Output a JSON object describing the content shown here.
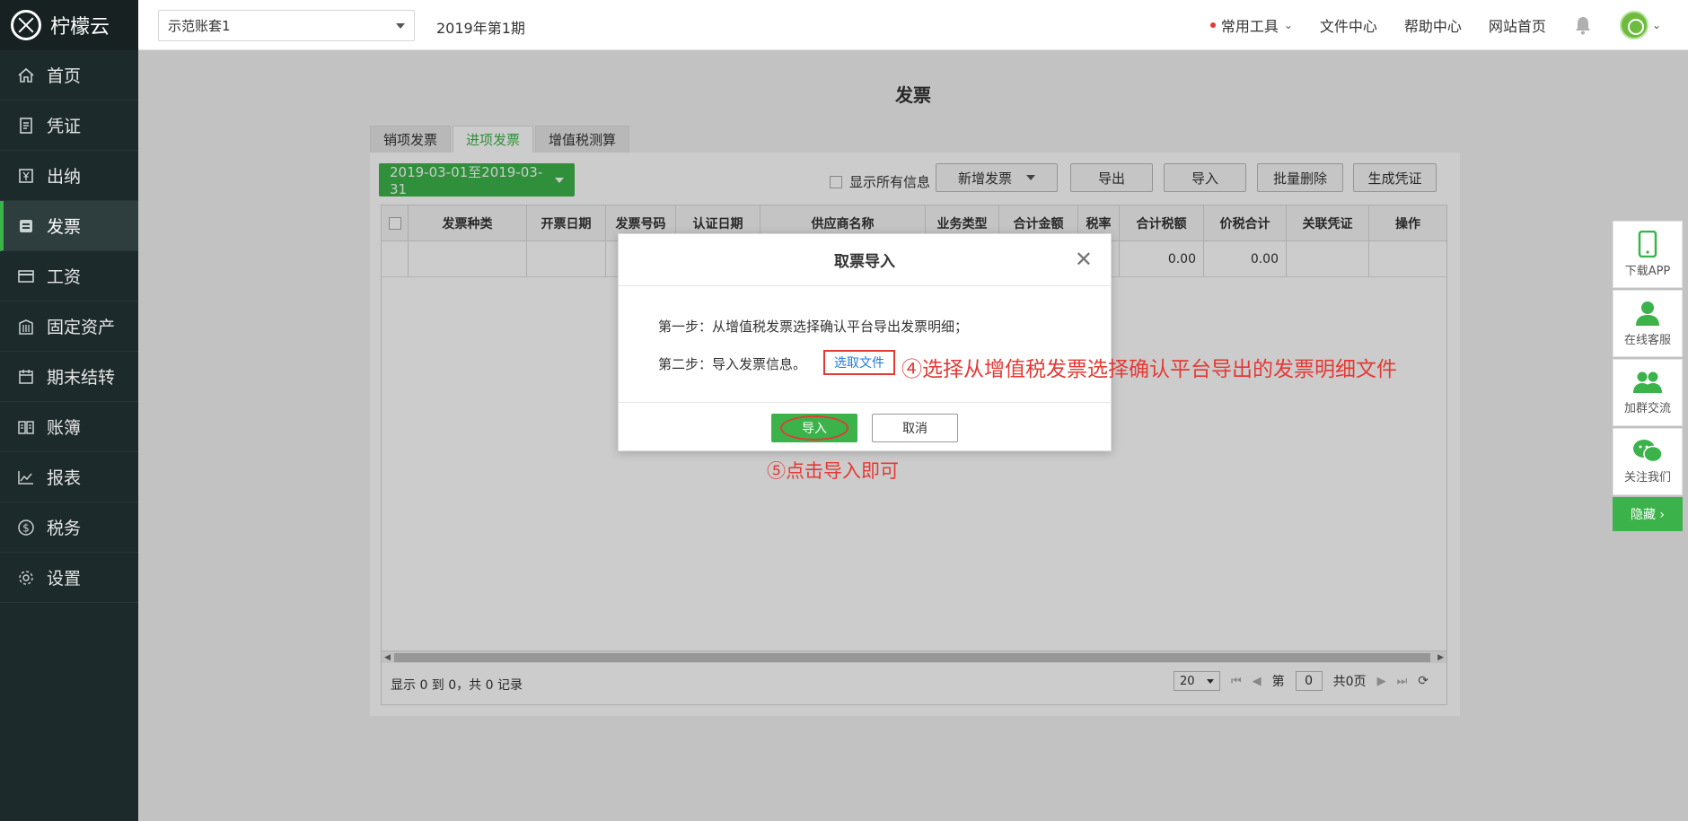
{
  "app": {
    "name": "柠檬云"
  },
  "sidebar": {
    "items": [
      {
        "label": "首页",
        "icon": "home-icon"
      },
      {
        "label": "凭证",
        "icon": "document-icon"
      },
      {
        "label": "出纳",
        "icon": "cashier-icon"
      },
      {
        "label": "发票",
        "icon": "invoice-icon",
        "active": true
      },
      {
        "label": "工资",
        "icon": "card-icon"
      },
      {
        "label": "固定资产",
        "icon": "building-icon"
      },
      {
        "label": "期末结转",
        "icon": "calendar-icon"
      },
      {
        "label": "账簿",
        "icon": "book-icon"
      },
      {
        "label": "报表",
        "icon": "chart-icon"
      },
      {
        "label": "税务",
        "icon": "dollar-icon"
      },
      {
        "label": "设置",
        "icon": "gear-icon"
      }
    ]
  },
  "topbar": {
    "account": "示范账套1",
    "period": "2019年第1期",
    "tools": "常用工具",
    "file_center": "文件中心",
    "help_center": "帮助中心",
    "site_home": "网站首页"
  },
  "page": {
    "title": "发票",
    "tabs": [
      "销项发票",
      "进项发票",
      "增值税测算"
    ],
    "active_tab": 1,
    "date_range": "2019-03-01至2019-03-31",
    "show_all_label": "显示所有信息",
    "buttons": {
      "add": "新增发票",
      "export": "导出",
      "import": "导入",
      "batch_delete": "批量删除",
      "generate": "生成凭证"
    }
  },
  "table": {
    "columns": [
      "发票种类",
      "开票日期",
      "发票号码",
      "认证日期",
      "供应商名称",
      "业务类型",
      "合计金额",
      "税率",
      "合计税额",
      "价税合计",
      "关联凭证",
      "操作"
    ],
    "rows": [
      [
        "",
        "",
        "",
        "",
        "",
        "",
        "",
        "",
        "0.00",
        "0.00",
        "",
        ""
      ]
    ],
    "footer_text": "显示 0 到 0，共 0 记录",
    "page_size": "20",
    "page_prefix": "第",
    "page_number": "0",
    "page_total": "共0页"
  },
  "dialog": {
    "title": "取票导入",
    "step1": "第一步：从增值税发票选择确认平台导出发票明细；",
    "step2": "第二步：导入发票信息。",
    "pick_file": "选取文件",
    "import": "导入",
    "cancel": "取消"
  },
  "annotations": {
    "step4": "④选择从增值税发票选择确认平台导出的发票明细文件",
    "step5": "⑤点击导入即可"
  },
  "float_panel": {
    "download_app": "下载APP",
    "online_service": "在线客服",
    "join_group": "加群交流",
    "follow_us": "关注我们",
    "hide": "隐藏 ›"
  },
  "colors": {
    "brand": "#3bb34a",
    "sidebar": "#1d2a2b",
    "annotation": "#e53935",
    "link": "#1e7be0"
  }
}
